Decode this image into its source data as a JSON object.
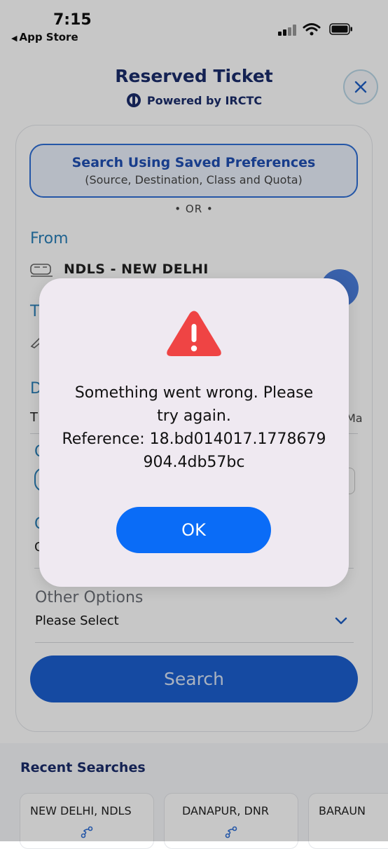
{
  "status_bar": {
    "time": "7:15",
    "back_app": "App Store",
    "icons": [
      "signal-icon",
      "wifi-icon",
      "battery-icon"
    ]
  },
  "header": {
    "title": "Reserved Ticket",
    "powered_by": "Powered by IRCTC",
    "close_icon": "close-icon"
  },
  "form": {
    "saved_pref_title": "Search Using Saved Preferences",
    "saved_pref_subtitle": "(Source, Destination, Class and Quota)",
    "or_text": "• OR •",
    "from_label": "From",
    "from_value": "NDLS - NEW DELHI",
    "to_label": "T",
    "date_label": "D",
    "date_value": "T",
    "date_right": "Ma",
    "class_label": "C",
    "quota_label": "C",
    "quota_value": "C",
    "other_label": "Other Options",
    "other_value": "Please Select",
    "search_label": "Search"
  },
  "recent": {
    "title": "Recent Searches",
    "items": [
      {
        "label": "NEW DELHI, NDLS"
      },
      {
        "label": "DANAPUR, DNR"
      },
      {
        "label": "BARAUN"
      }
    ]
  },
  "dialog": {
    "icon": "warning-icon",
    "message_line1": "Something went wrong. Please",
    "message_line2": "try again.",
    "message_line3": "Reference: 18.bd014017.1778679",
    "message_line4": "904.4db57bc",
    "ok_label": "OK"
  },
  "colors": {
    "brand_navy": "#1a2c6b",
    "link_blue": "#2a7fb8",
    "primary_button": "#1c5fd0",
    "dialog_button": "#0a6cf7",
    "warning_red": "#ef4444"
  }
}
